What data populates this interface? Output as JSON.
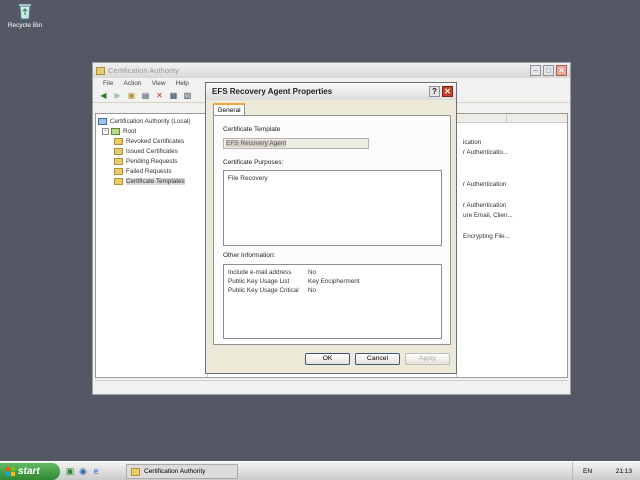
{
  "desktop": {
    "recycle_bin_label": "Recycle Bin"
  },
  "ca_window": {
    "title": "Certification Authority",
    "menu": [
      "File",
      "Action",
      "View",
      "Help"
    ],
    "tree": {
      "root_label": "Certification Authority (Local)",
      "child": "Root",
      "items": [
        "Revoked Certificates",
        "Issued Certificates",
        "Pending Requests",
        "Failed Requests",
        "Certificate Templates"
      ],
      "selected": "Certificate Templates"
    },
    "right_list_fragments": [
      "ication",
      "r Authenticatio...",
      "r Authentication",
      "r Authentication",
      "ure Email, Clien...",
      "Encrypting File..."
    ]
  },
  "dialog": {
    "title": "EFS Recovery Agent Properties",
    "tab_general": "General",
    "cert_template_label": "Certificate Template",
    "cert_template_value": "EFS Recovery Agent",
    "purposes_label": "Certificate Purposes:",
    "purposes": [
      "File Recovery"
    ],
    "other_info_label": "Other Information:",
    "other_info": [
      {
        "key": "Include e-mail address",
        "value": "No"
      },
      {
        "key": "Public Key Usage List",
        "value": "Key Encipherment"
      },
      {
        "key": "Public Key Usage Critical",
        "value": "No"
      }
    ],
    "ok_label": "OK",
    "cancel_label": "Cancel",
    "apply_label": "Apply"
  },
  "taskbar": {
    "start_label": "start",
    "task_label": "Certification Authority",
    "language": "EN",
    "clock": "21:13"
  }
}
